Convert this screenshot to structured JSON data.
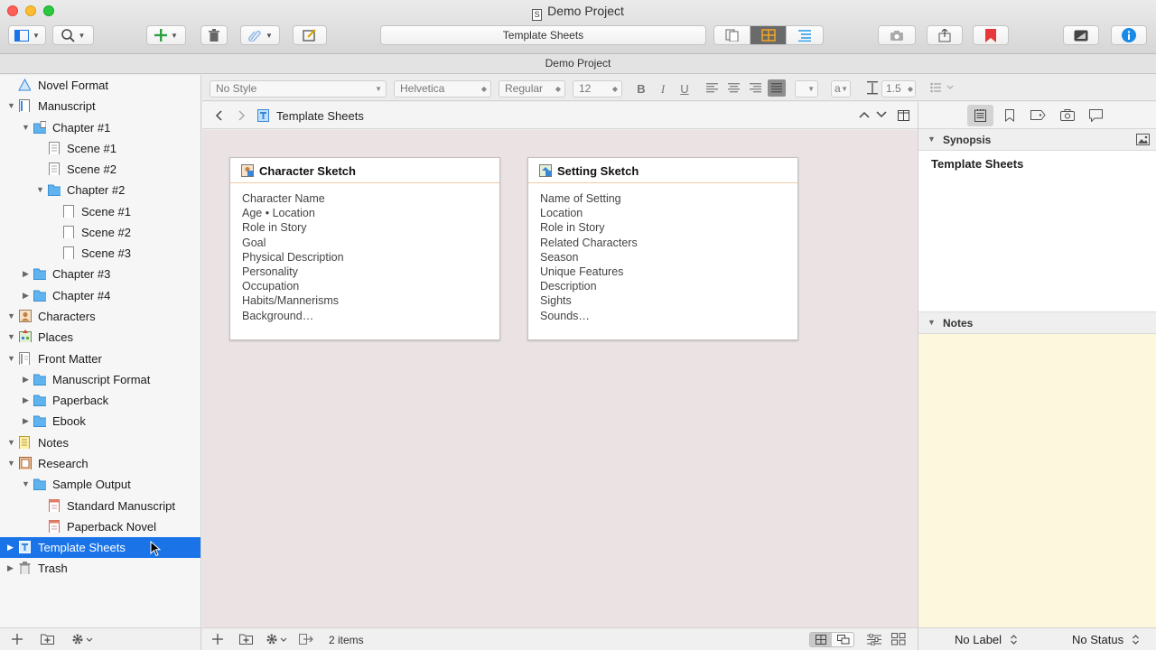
{
  "window": {
    "title": "Demo Project",
    "subtitle": "Demo Project"
  },
  "toolbar": {
    "center_label": "Template Sheets"
  },
  "format_bar": {
    "style": "No Style",
    "font": "Helvetica",
    "weight": "Regular",
    "size": "12",
    "bold": "B",
    "italic": "I",
    "underline": "U",
    "highlight": "a",
    "line_spacing": "1.5"
  },
  "binder": {
    "items": [
      {
        "label": "Novel Format",
        "icon": "warning-icon"
      },
      {
        "label": "Manuscript",
        "icon": "manuscript-icon"
      },
      {
        "label": "Chapter #1",
        "icon": "folder-icon"
      },
      {
        "label": "Scene #1",
        "icon": "text-doc-icon"
      },
      {
        "label": "Scene #2",
        "icon": "text-doc-icon"
      },
      {
        "label": "Chapter #2",
        "icon": "folder-icon"
      },
      {
        "label": "Scene #1",
        "icon": "blank-doc-icon"
      },
      {
        "label": "Scene #2",
        "icon": "blank-doc-icon"
      },
      {
        "label": "Scene #3",
        "icon": "blank-doc-icon"
      },
      {
        "label": "Chapter #3",
        "icon": "folder-icon"
      },
      {
        "label": "Chapter #4",
        "icon": "folder-icon"
      },
      {
        "label": "Characters",
        "icon": "characters-icon"
      },
      {
        "label": "Places",
        "icon": "places-icon"
      },
      {
        "label": "Front Matter",
        "icon": "front-matter-icon"
      },
      {
        "label": "Manuscript Format",
        "icon": "folder-icon"
      },
      {
        "label": "Paperback",
        "icon": "folder-icon"
      },
      {
        "label": "Ebook",
        "icon": "folder-icon"
      },
      {
        "label": "Notes",
        "icon": "notes-icon"
      },
      {
        "label": "Research",
        "icon": "research-icon"
      },
      {
        "label": "Sample Output",
        "icon": "folder-icon"
      },
      {
        "label": "Standard Manuscript",
        "icon": "compile-doc-icon"
      },
      {
        "label": "Paperback Novel",
        "icon": "compile-doc-icon"
      },
      {
        "label": "Template Sheets",
        "icon": "template-icon"
      },
      {
        "label": "Trash",
        "icon": "trash-icon"
      }
    ]
  },
  "editor": {
    "header_title": "Template Sheets",
    "item_count": "2 items",
    "cards": [
      {
        "title": "Character Sketch",
        "lines": [
          "Character Name",
          "Age • Location",
          "Role in Story",
          "Goal",
          "Physical Description",
          "Personality",
          "Occupation",
          "Habits/Mannerisms",
          "Background…"
        ]
      },
      {
        "title": "Setting Sketch",
        "lines": [
          "Name of Setting",
          "Location",
          "Role in Story",
          "Related Characters",
          "Season",
          "Unique Features",
          "Description",
          "Sights",
          "Sounds…"
        ]
      }
    ]
  },
  "inspector": {
    "synopsis_header": "Synopsis",
    "synopsis_title": "Template Sheets",
    "notes_header": "Notes",
    "label_value": "No Label",
    "status_value": "No Status"
  },
  "colors": {
    "selection": "#1a74e8",
    "corkboard": "#ebe3e3",
    "notes": "#fdf8dd",
    "folder": "#5fb3ee"
  }
}
